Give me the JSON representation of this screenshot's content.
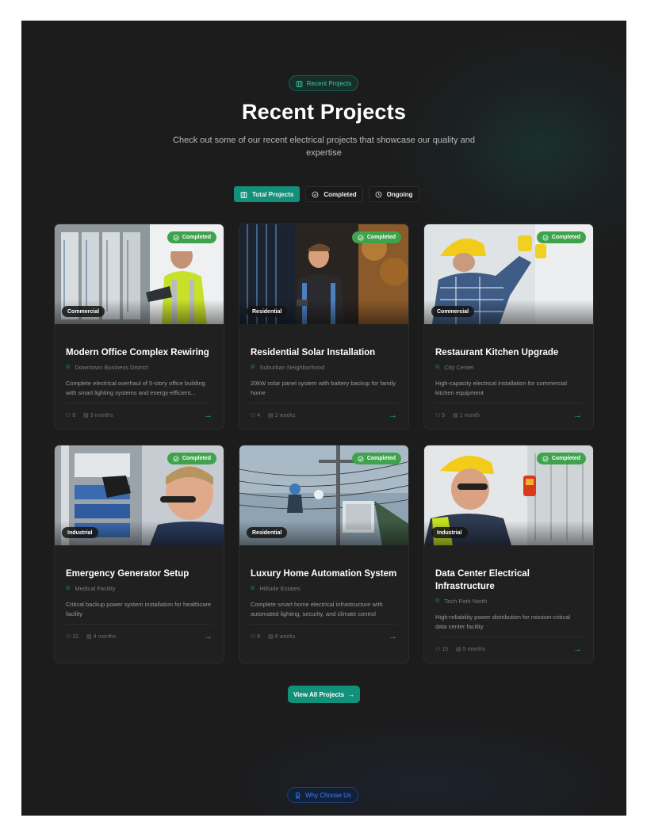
{
  "section_pill": {
    "label": "Recent Projects",
    "icon": "building-icon"
  },
  "heading": "Recent Projects",
  "subheading": "Check out some of our recent electrical projects that showcase our quality and expertise",
  "filters": [
    {
      "label": "Total Projects",
      "icon": "building-icon",
      "active": true
    },
    {
      "label": "Completed",
      "icon": "check-circle-icon",
      "active": false
    },
    {
      "label": "Ongoing",
      "icon": "clock-icon",
      "active": false
    }
  ],
  "projects": [
    {
      "title": "Modern Office Complex Rewiring",
      "location": "Downtown Business District",
      "description": "Complete electrical overhaul of 5-story office building with smart lighting systems and energy-efficient...",
      "category": "Commercial",
      "status": "Completed",
      "team": "8",
      "duration": "3 months"
    },
    {
      "title": "Residential Solar Installation",
      "location": "Suburban Neighborhood",
      "description": "20kW solar panel system with battery backup for family home",
      "category": "Residential",
      "status": "Completed",
      "team": "4",
      "duration": "2 weeks"
    },
    {
      "title": "Restaurant Kitchen Upgrade",
      "location": "City Center",
      "description": "High-capacity electrical installation for commercial kitchen equipment",
      "category": "Commercial",
      "status": "Completed",
      "team": "5",
      "duration": "1 month"
    },
    {
      "title": "Emergency Generator Setup",
      "location": "Medical Facility",
      "description": "Critical backup power system installation for healthcare facility",
      "category": "Industrial",
      "status": "Completed",
      "team": "12",
      "duration": "4 months"
    },
    {
      "title": "Luxury Home Automation System",
      "location": "Hillside Estates",
      "description": "Complete smart home electrical infrastructure with automated lighting, security, and climate control",
      "category": "Residential",
      "status": "Completed",
      "team": "6",
      "duration": "6 weeks"
    },
    {
      "title": "Data Center Electrical Infrastructure",
      "location": "Tech Park North",
      "description": "High-reliability power distribution for mission-critical data center facility",
      "category": "Industrial",
      "status": "Completed",
      "team": "15",
      "duration": "5 months"
    }
  ],
  "view_all": {
    "label": "View All Projects",
    "icon": "arrow-right-icon"
  },
  "next_section_pill": {
    "label": "Why Choose Us",
    "icon": "award-icon"
  },
  "colors": {
    "accent": "#12917a",
    "status": "#3fa34d",
    "background": "#1c1c1d",
    "card": "#202021",
    "blue": "#3b82f6"
  }
}
